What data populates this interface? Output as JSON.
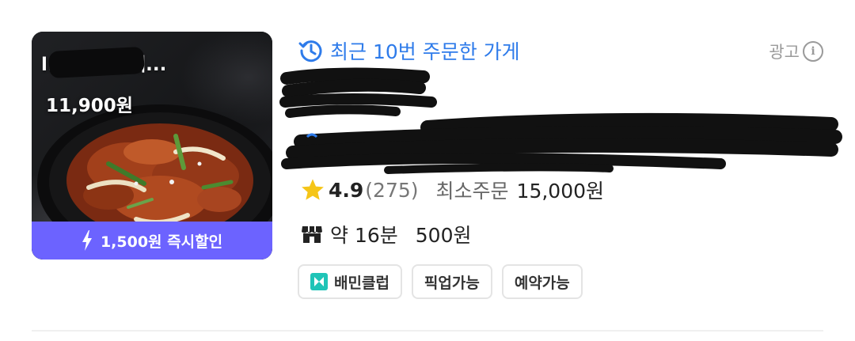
{
  "thumbnail": {
    "title": "l:        ɜ」직화 제...",
    "price": "11,900원",
    "discount": "1,500원 즉시할인",
    "icon": "lightning-bolt-icon"
  },
  "recent_order": {
    "label": "최근 10번 주문한 가게",
    "icon": "clock-history-icon",
    "color": "#2e7bea"
  },
  "ad": {
    "label": "광고",
    "icon": "info-icon"
  },
  "rating": {
    "score": "4.9",
    "count": "(275)",
    "icon": "star-icon",
    "star_color": "#f5c518"
  },
  "min_order": {
    "label": "최소주문",
    "value": "15,000원"
  },
  "delivery": {
    "icon": "storefront-icon",
    "time": "약 16분",
    "fee": "500원"
  },
  "tags": [
    {
      "label": "배민클럽",
      "icon": "baemin-club-icon",
      "icon_color": "#1fc4b7"
    },
    {
      "label": "픽업가능"
    },
    {
      "label": "예약가능"
    }
  ],
  "colors": {
    "discount_bar": "#6c63ff"
  }
}
